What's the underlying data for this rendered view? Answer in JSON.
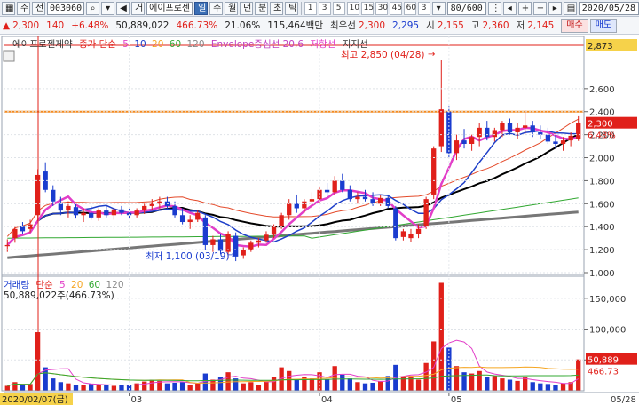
{
  "toolbar": {
    "tab_label": "주",
    "market_label": "전",
    "code": "003060",
    "name_toggle": "거",
    "name": "에이프로젠",
    "periods": [
      "일",
      "주",
      "월",
      "년",
      "분",
      "초",
      "틱"
    ],
    "active_period": "일",
    "interval_nums": [
      "1",
      "3",
      "5",
      "10",
      "15",
      "30",
      "45",
      "60"
    ],
    "interval_value": "3",
    "count": "80/600",
    "date": "2020/05/28"
  },
  "quote": {
    "price": "2,300",
    "change": "140",
    "change_pct": "+6.48%",
    "volume": "50,889,022",
    "volume_pct": "466.73%",
    "turnover": "21.06%",
    "amount": "115,464백만",
    "best_label": "최우선",
    "ask": "2,300",
    "bid": "2,295",
    "open_label": "시",
    "open": "2,155",
    "high_label": "고",
    "high": "2,360",
    "low_label": "저",
    "low": "2,145",
    "buy_label": "매수",
    "sell_label": "매도"
  },
  "price_panel": {
    "title": "에이프로젠제약",
    "ma_label": "종가 단순",
    "ma_periods": [
      "5",
      "10",
      "20",
      "60",
      "120"
    ],
    "envelope_label": "Envelope중심선 20,6",
    "resistance_label": "저항선",
    "support_label": "지지선",
    "high_note": "최고 2,850 (04/28)",
    "low_note": "최저 1,100 (03/19)",
    "right_top_value": "2,873",
    "price_tag": "2,300",
    "pct_tag": "6.48%"
  },
  "volume_panel": {
    "title": "거래량",
    "ma_label": "단순",
    "ma_periods": [
      "5",
      "20",
      "60",
      "120"
    ],
    "info": "50,889,022주(466.73%)",
    "value_tag": "50,889",
    "pct_tag": "466.73"
  },
  "x_axis": {
    "start_label": "2020/02/07(금)",
    "month_labels": [
      "03",
      "04",
      "05"
    ],
    "end_label": "05/28"
  },
  "colors": {
    "up": "#e0201a",
    "down": "#1a3ccf",
    "ma5": "#e23ec8",
    "ma10": "#1e3fc9",
    "ma20": "#e44a2a",
    "ma60": "#000000",
    "ma120": "#32a832",
    "envelope": "#8a8a8a",
    "resistance": "#f58a1f",
    "support": "#e23ec8"
  },
  "chart_data": [
    {
      "type": "line",
      "title": "에이프로젠제약",
      "ylim": [
        1000,
        2900
      ],
      "yticks": [
        2600,
        2400,
        2200,
        2000,
        1800,
        1600,
        1400,
        1200,
        1000
      ],
      "resistance_level": 2400,
      "candles": [
        {
          "o": 1230,
          "h": 1290,
          "l": 1180,
          "c": 1240
        },
        {
          "o": 1300,
          "h": 1400,
          "l": 1260,
          "c": 1380
        },
        {
          "o": 1400,
          "h": 1440,
          "l": 1340,
          "c": 1360
        },
        {
          "o": 1380,
          "h": 1460,
          "l": 1350,
          "c": 1420
        },
        {
          "o": 1500,
          "h": 1900,
          "l": 1450,
          "c": 1850
        },
        {
          "o": 1880,
          "h": 1960,
          "l": 1700,
          "c": 1720
        },
        {
          "o": 1720,
          "h": 1760,
          "l": 1580,
          "c": 1620
        },
        {
          "o": 1600,
          "h": 1660,
          "l": 1500,
          "c": 1540
        },
        {
          "o": 1540,
          "h": 1620,
          "l": 1480,
          "c": 1580
        },
        {
          "o": 1570,
          "h": 1610,
          "l": 1470,
          "c": 1500
        },
        {
          "o": 1500,
          "h": 1560,
          "l": 1440,
          "c": 1520
        },
        {
          "o": 1520,
          "h": 1580,
          "l": 1460,
          "c": 1480
        },
        {
          "o": 1480,
          "h": 1560,
          "l": 1450,
          "c": 1540
        },
        {
          "o": 1540,
          "h": 1580,
          "l": 1480,
          "c": 1500
        },
        {
          "o": 1500,
          "h": 1560,
          "l": 1460,
          "c": 1550
        },
        {
          "o": 1550,
          "h": 1580,
          "l": 1500,
          "c": 1520
        },
        {
          "o": 1520,
          "h": 1560,
          "l": 1470,
          "c": 1500
        },
        {
          "o": 1500,
          "h": 1560,
          "l": 1480,
          "c": 1540
        },
        {
          "o": 1540,
          "h": 1600,
          "l": 1510,
          "c": 1580
        },
        {
          "o": 1580,
          "h": 1640,
          "l": 1540,
          "c": 1600
        },
        {
          "o": 1600,
          "h": 1660,
          "l": 1560,
          "c": 1620
        },
        {
          "o": 1620,
          "h": 1660,
          "l": 1560,
          "c": 1580
        },
        {
          "o": 1580,
          "h": 1620,
          "l": 1480,
          "c": 1500
        },
        {
          "o": 1500,
          "h": 1560,
          "l": 1420,
          "c": 1440
        },
        {
          "o": 1440,
          "h": 1500,
          "l": 1380,
          "c": 1460
        },
        {
          "o": 1460,
          "h": 1540,
          "l": 1440,
          "c": 1520
        },
        {
          "o": 1480,
          "h": 1500,
          "l": 1200,
          "c": 1240
        },
        {
          "o": 1240,
          "h": 1320,
          "l": 1180,
          "c": 1290
        },
        {
          "o": 1290,
          "h": 1340,
          "l": 1160,
          "c": 1190
        },
        {
          "o": 1180,
          "h": 1360,
          "l": 1120,
          "c": 1340
        },
        {
          "o": 1320,
          "h": 1350,
          "l": 1100,
          "c": 1140
        },
        {
          "o": 1150,
          "h": 1220,
          "l": 1120,
          "c": 1200
        },
        {
          "o": 1200,
          "h": 1280,
          "l": 1180,
          "c": 1260
        },
        {
          "o": 1260,
          "h": 1300,
          "l": 1220,
          "c": 1280
        },
        {
          "o": 1280,
          "h": 1360,
          "l": 1260,
          "c": 1330
        },
        {
          "o": 1330,
          "h": 1420,
          "l": 1300,
          "c": 1400
        },
        {
          "o": 1400,
          "h": 1520,
          "l": 1380,
          "c": 1500
        },
        {
          "o": 1500,
          "h": 1640,
          "l": 1460,
          "c": 1600
        },
        {
          "o": 1600,
          "h": 1680,
          "l": 1520,
          "c": 1560
        },
        {
          "o": 1560,
          "h": 1640,
          "l": 1520,
          "c": 1620
        },
        {
          "o": 1620,
          "h": 1700,
          "l": 1560,
          "c": 1640
        },
        {
          "o": 1640,
          "h": 1740,
          "l": 1600,
          "c": 1720
        },
        {
          "o": 1720,
          "h": 1780,
          "l": 1660,
          "c": 1700
        },
        {
          "o": 1700,
          "h": 1840,
          "l": 1680,
          "c": 1800
        },
        {
          "o": 1800,
          "h": 1860,
          "l": 1700,
          "c": 1720
        },
        {
          "o": 1720,
          "h": 1760,
          "l": 1620,
          "c": 1640
        },
        {
          "o": 1640,
          "h": 1700,
          "l": 1600,
          "c": 1660
        },
        {
          "o": 1660,
          "h": 1720,
          "l": 1620,
          "c": 1640
        },
        {
          "o": 1640,
          "h": 1700,
          "l": 1580,
          "c": 1600
        },
        {
          "o": 1600,
          "h": 1680,
          "l": 1580,
          "c": 1650
        },
        {
          "o": 1650,
          "h": 1680,
          "l": 1560,
          "c": 1580
        },
        {
          "o": 1560,
          "h": 1580,
          "l": 1280,
          "c": 1300
        },
        {
          "o": 1310,
          "h": 1380,
          "l": 1280,
          "c": 1360
        },
        {
          "o": 1300,
          "h": 1380,
          "l": 1270,
          "c": 1340
        },
        {
          "o": 1340,
          "h": 1420,
          "l": 1300,
          "c": 1380
        },
        {
          "o": 1400,
          "h": 1660,
          "l": 1380,
          "c": 1640
        },
        {
          "o": 1680,
          "h": 2100,
          "l": 1640,
          "c": 2080
        },
        {
          "o": 2100,
          "h": 2850,
          "l": 2050,
          "c": 2420
        },
        {
          "o": 2400,
          "h": 2450,
          "l": 2000,
          "c": 2040
        },
        {
          "o": 2040,
          "h": 2200,
          "l": 1980,
          "c": 2150
        },
        {
          "o": 2150,
          "h": 2250,
          "l": 2080,
          "c": 2120
        },
        {
          "o": 2120,
          "h": 2200,
          "l": 2060,
          "c": 2180
        },
        {
          "o": 2180,
          "h": 2300,
          "l": 2100,
          "c": 2260
        },
        {
          "o": 2260,
          "h": 2320,
          "l": 2150,
          "c": 2180
        },
        {
          "o": 2180,
          "h": 2260,
          "l": 2140,
          "c": 2240
        },
        {
          "o": 2240,
          "h": 2320,
          "l": 2180,
          "c": 2300
        },
        {
          "o": 2300,
          "h": 2340,
          "l": 2200,
          "c": 2220
        },
        {
          "o": 2220,
          "h": 2300,
          "l": 2160,
          "c": 2260
        },
        {
          "o": 2260,
          "h": 2410,
          "l": 2200,
          "c": 2280
        },
        {
          "o": 2280,
          "h": 2320,
          "l": 2180,
          "c": 2220
        },
        {
          "o": 2220,
          "h": 2280,
          "l": 2160,
          "c": 2200
        },
        {
          "o": 2200,
          "h": 2260,
          "l": 2120,
          "c": 2140
        },
        {
          "o": 2140,
          "h": 2200,
          "l": 2080,
          "c": 2120
        },
        {
          "o": 2120,
          "h": 2180,
          "l": 2060,
          "c": 2150
        },
        {
          "o": 2150,
          "h": 2220,
          "l": 2100,
          "c": 2190
        },
        {
          "o": 2160,
          "h": 2360,
          "l": 2145,
          "c": 2300
        }
      ]
    },
    {
      "type": "bar",
      "title": "거래량",
      "ylim": [
        0,
        180000
      ],
      "yticks": [
        150000,
        100000,
        50000
      ],
      "volumes": [
        8000,
        14000,
        9000,
        11000,
        95000,
        38000,
        20000,
        14000,
        12000,
        10000,
        9000,
        11000,
        10000,
        9000,
        8000,
        9000,
        10000,
        12000,
        15000,
        18000,
        16000,
        12000,
        13000,
        14000,
        10000,
        12000,
        28000,
        18000,
        22000,
        30000,
        20000,
        12000,
        14000,
        10000,
        16000,
        22000,
        38000,
        32000,
        18000,
        22000,
        20000,
        30000,
        18000,
        40000,
        26000,
        20000,
        14000,
        12000,
        13000,
        16000,
        24000,
        42000,
        22000,
        24000,
        18000,
        45000,
        80000,
        175000,
        70000,
        40000,
        30000,
        28000,
        32000,
        22000,
        24000,
        20000,
        18000,
        16000,
        22000,
        14000,
        12000,
        11000,
        10000,
        12000,
        14000,
        50889
      ]
    }
  ]
}
